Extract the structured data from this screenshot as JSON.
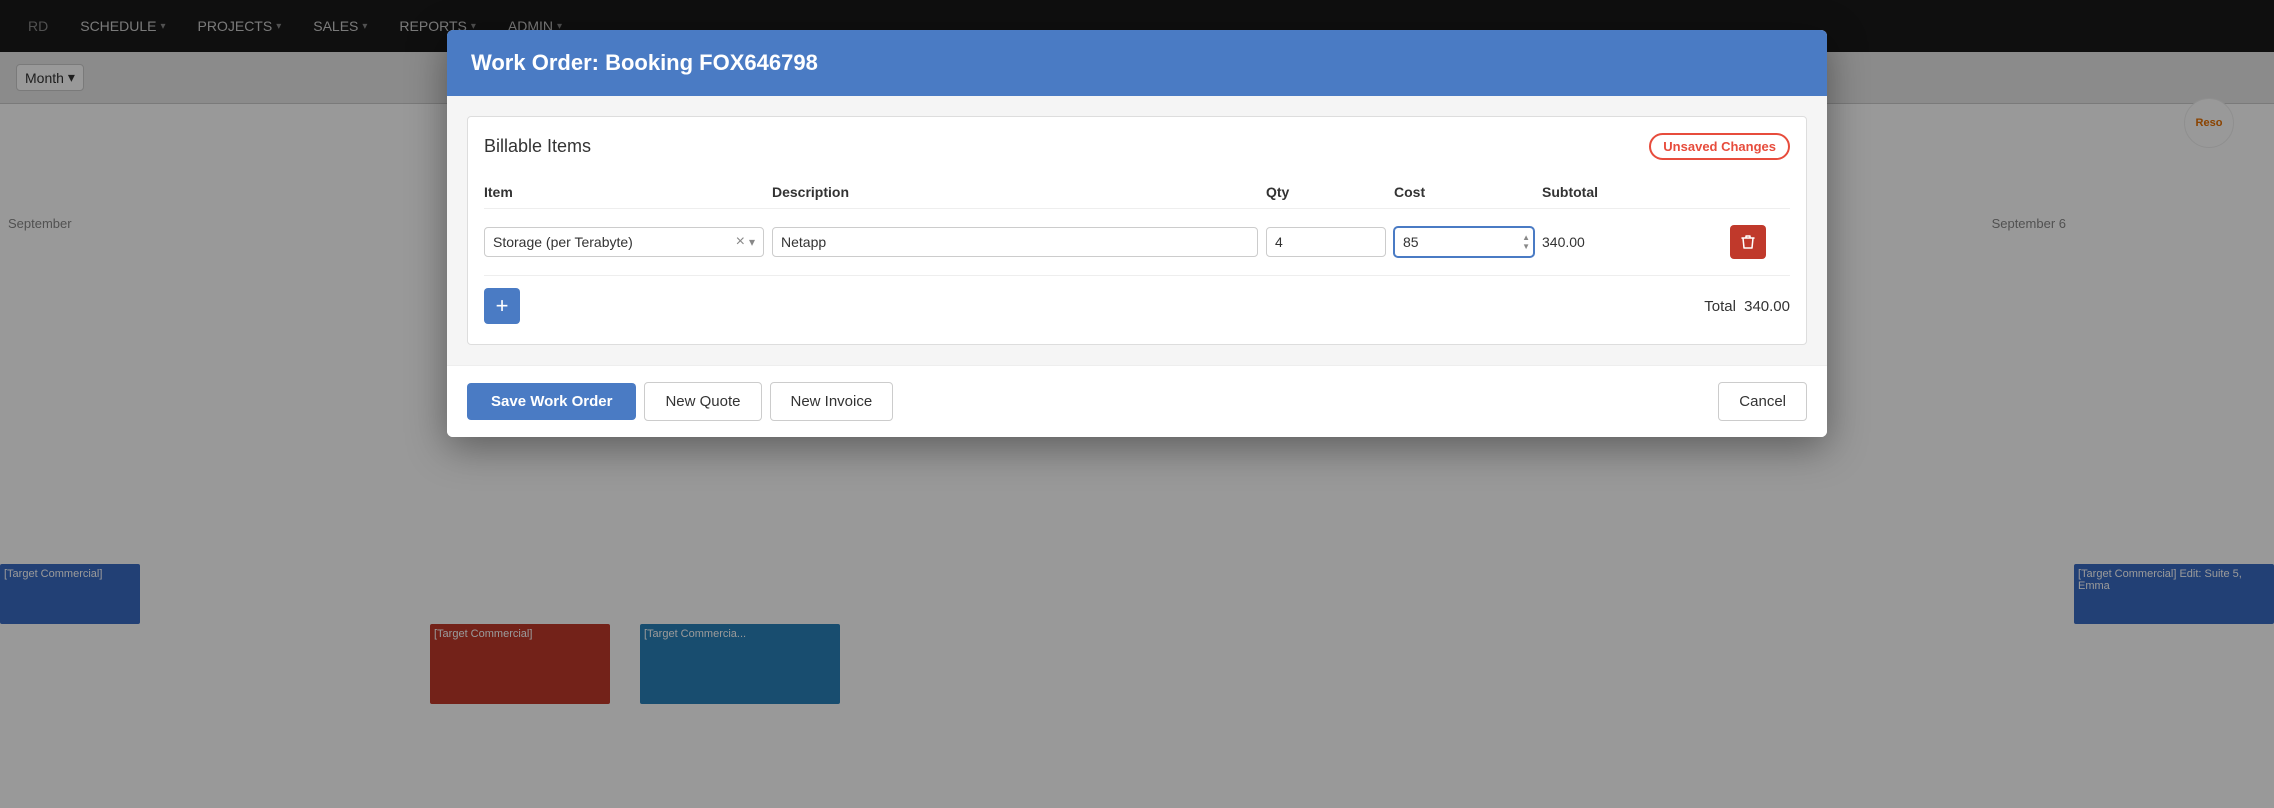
{
  "navbar": {
    "items": [
      {
        "label": "SCHEDULE",
        "id": "schedule"
      },
      {
        "label": "PROJECTS",
        "id": "projects"
      },
      {
        "label": "SALES",
        "id": "sales"
      },
      {
        "label": "REPORTS",
        "id": "reports"
      },
      {
        "label": "ADMIN",
        "id": "admin"
      }
    ]
  },
  "month_dropdown": {
    "label": "Month",
    "arrow": "▾"
  },
  "calendar": {
    "label_left": "September",
    "label_right": "September 6"
  },
  "bg_events": {
    "event1_text": "[Target\nCommercial]",
    "event2_text": "[Target Commercial] Edit:\nSuite 5, Emma",
    "event3_text": "[Target\nCommercial]",
    "event4_text": "[Target\nCommercia..."
  },
  "modal": {
    "title": "Work Order: Booking FOX646798",
    "billable_section_title": "Billable Items",
    "unsaved_label": "Unsaved Changes",
    "columns": {
      "item": "Item",
      "description": "Description",
      "qty": "Qty",
      "cost": "Cost",
      "subtotal": "Subtotal"
    },
    "row": {
      "item_value": "Storage (per Terabyte)",
      "description_value": "Netapp",
      "qty_value": "4",
      "cost_value": "85",
      "subtotal_value": "340.00"
    },
    "total_label": "Total",
    "total_value": "340.00",
    "footer": {
      "save_label": "Save Work Order",
      "new_quote_label": "New Quote",
      "new_invoice_label": "New Invoice",
      "cancel_label": "Cancel"
    }
  }
}
